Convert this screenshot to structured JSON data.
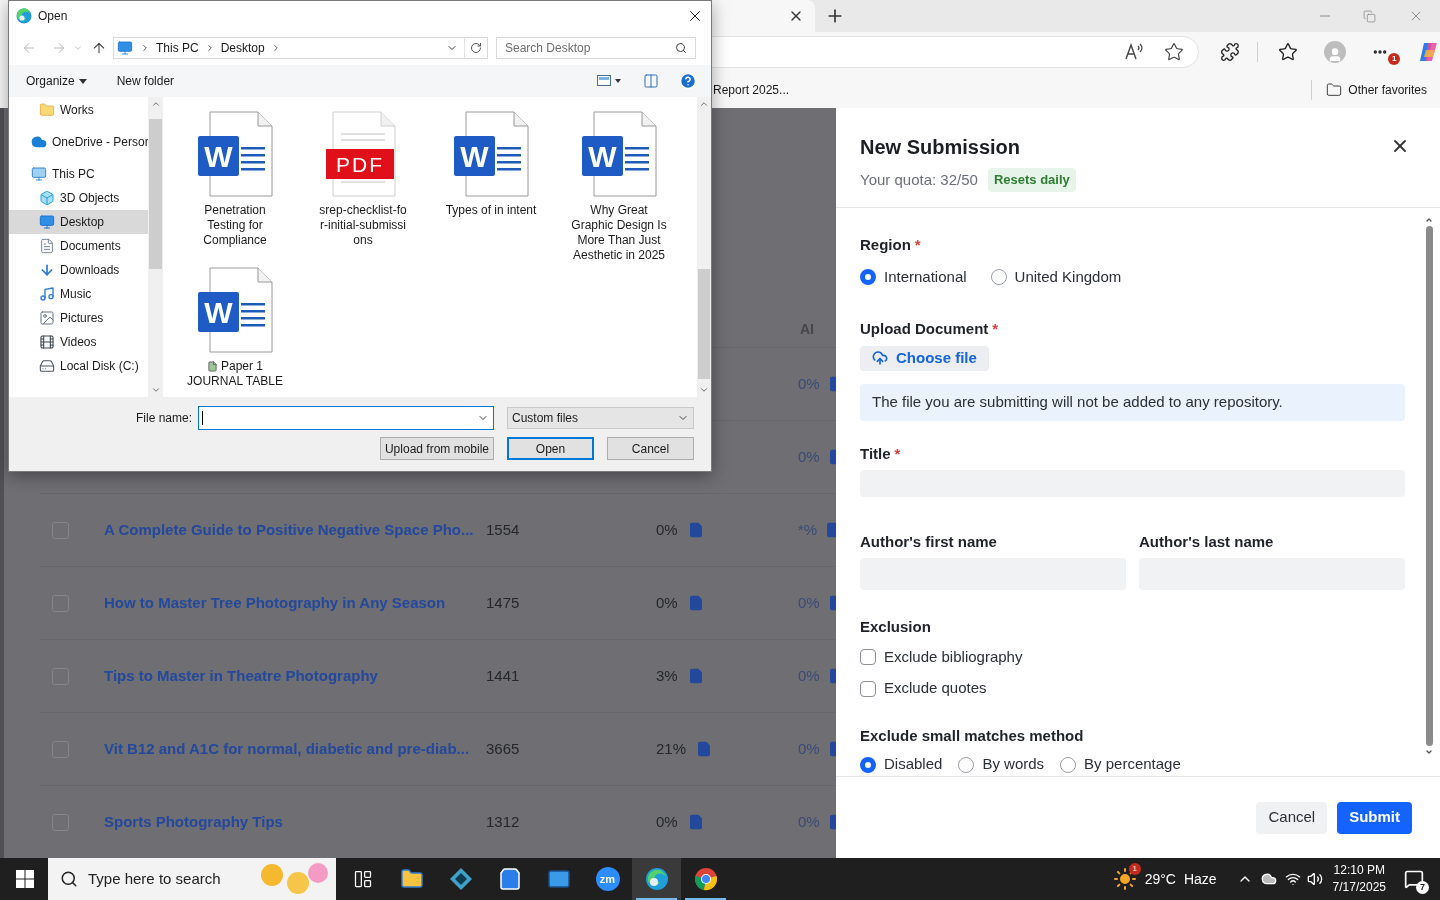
{
  "browser": {
    "favorites": [
      {
        "label": "Report 2025..."
      }
    ],
    "other_favorites": "Other favorites",
    "menu_badge": "1"
  },
  "table": {
    "columns": [
      {
        "label": "AI"
      }
    ],
    "rows": [
      {
        "ai": "0%"
      },
      {
        "ai": "0%"
      },
      {
        "checked": false,
        "title": "A Complete Guide to Positive Negative Space Pho...",
        "count": "1554",
        "similarity": "0%",
        "ai": "*%"
      },
      {
        "checked": false,
        "title": "How to Master Tree Photography in Any Season",
        "count": "1475",
        "similarity": "0%",
        "ai": "0%"
      },
      {
        "checked": false,
        "title": "Tips to Master in Theatre Photography",
        "count": "1441",
        "similarity": "3%",
        "ai": "0%"
      },
      {
        "checked": false,
        "title": "Vit B12 and A1C for normal, diabetic and pre-diab...",
        "count": "3665",
        "similarity": "21%",
        "ai": "0%"
      },
      {
        "checked": false,
        "title": "Sports Photography Tips",
        "count": "1312",
        "similarity": "0%",
        "ai": "0%"
      }
    ]
  },
  "drawer": {
    "title": "New Submission",
    "quota": "Your quota: 32/50",
    "quota_badge": "Resets daily",
    "region": {
      "label": "Region",
      "required_mark": "*",
      "options": [
        {
          "label": "International",
          "selected": true
        },
        {
          "label": "United Kingdom",
          "selected": false
        }
      ]
    },
    "upload": {
      "label": "Upload Document",
      "required_mark": "*",
      "button": "Choose file",
      "notice": "The file you are submitting will not be added to any repository."
    },
    "title_field": {
      "label": "Title",
      "required_mark": "*"
    },
    "author_fields": [
      {
        "label": "Author's first name"
      },
      {
        "label": "Author's last name"
      }
    ],
    "exclusion": {
      "label": "Exclusion",
      "options": [
        {
          "label": "Exclude bibliography",
          "checked": false
        },
        {
          "label": "Exclude quotes",
          "checked": false
        }
      ]
    },
    "small_matches": {
      "label": "Exclude small matches method",
      "options": [
        {
          "label": "Disabled",
          "selected": true
        },
        {
          "label": "By words",
          "selected": false
        },
        {
          "label": "By percentage",
          "selected": false
        }
      ]
    },
    "buttons": [
      {
        "label": "Cancel",
        "kind": "secondary"
      },
      {
        "label": "Submit",
        "kind": "primary"
      }
    ]
  },
  "dialog": {
    "title": "Open",
    "breadcrumb": [
      "This PC",
      "Desktop"
    ],
    "search": {
      "placeholder": "Search Desktop"
    },
    "toolbar": {
      "organize": "Organize",
      "new_folder": "New folder"
    },
    "nav_pane": {
      "scrolled_items": [
        {
          "label": "Works",
          "kind": "folder",
          "selected": false
        }
      ],
      "items": [
        {
          "label": "OneDrive - Persor",
          "kind": "cloud",
          "selected": false
        },
        {
          "label": "This PC",
          "kind": "pc",
          "selected": false,
          "children": [
            {
              "label": "3D Objects",
              "kind": "cube",
              "selected": false
            },
            {
              "label": "Desktop",
              "kind": "desktop",
              "selected": true
            },
            {
              "label": "Documents",
              "kind": "documents",
              "selected": false
            },
            {
              "label": "Downloads",
              "kind": "downloads",
              "selected": false
            },
            {
              "label": "Music",
              "kind": "music",
              "selected": false
            },
            {
              "label": "Pictures",
              "kind": "pictures",
              "selected": false
            },
            {
              "label": "Videos",
              "kind": "videos",
              "selected": false
            },
            {
              "label": "Local Disk (C:)",
              "kind": "disk",
              "selected": false
            }
          ]
        }
      ]
    },
    "files": [
      {
        "lines": [
          "Penetration",
          "Testing for",
          "Compliance"
        ],
        "kind": "word",
        "icon_text": "W"
      },
      {
        "lines": [
          "srep-checklist-fo",
          "r-initial-submissi",
          "ons"
        ],
        "kind": "pdf",
        "icon_text": "PDF"
      },
      {
        "lines": [
          "Types of in intent"
        ],
        "kind": "word",
        "icon_text": "W"
      },
      {
        "lines": [
          "Why Great",
          "Graphic Design Is",
          "More Than Just",
          "Aesthetic in 2025"
        ],
        "kind": "word",
        "icon_text": "W"
      },
      {
        "lines": [
          "Paper 1",
          "JOURNAL TABLE"
        ],
        "kind": "word",
        "icon_text": "W",
        "prefix_icon": true
      }
    ],
    "file_name": {
      "label": "File name:"
    },
    "file_type": "Custom files",
    "buttons": [
      {
        "label": "Upload from mobile",
        "default": false
      },
      {
        "label": "Open",
        "default": true
      },
      {
        "label": "Cancel",
        "default": false
      }
    ]
  },
  "taskbar": {
    "search": {
      "placeholder": "Type here to search"
    },
    "apps": [
      {
        "kind": "task_view",
        "running": false,
        "active": false
      },
      {
        "kind": "explorer",
        "running": false,
        "active": false
      },
      {
        "kind": "diamond",
        "running": false,
        "active": false
      },
      {
        "kind": "store",
        "running": false,
        "active": false
      },
      {
        "kind": "mail",
        "running": false,
        "active": false
      },
      {
        "kind": "zoom",
        "label": "zm",
        "running": false,
        "active": false
      },
      {
        "kind": "edge",
        "running": true,
        "active": true
      },
      {
        "kind": "chrome",
        "running": true,
        "active": false
      }
    ],
    "weather": {
      "badge": "1",
      "temp": "29°C",
      "condition": "Haze"
    },
    "clock": {
      "time": "12:10 PM",
      "date": "7/17/2025"
    },
    "notifications": "7"
  }
}
